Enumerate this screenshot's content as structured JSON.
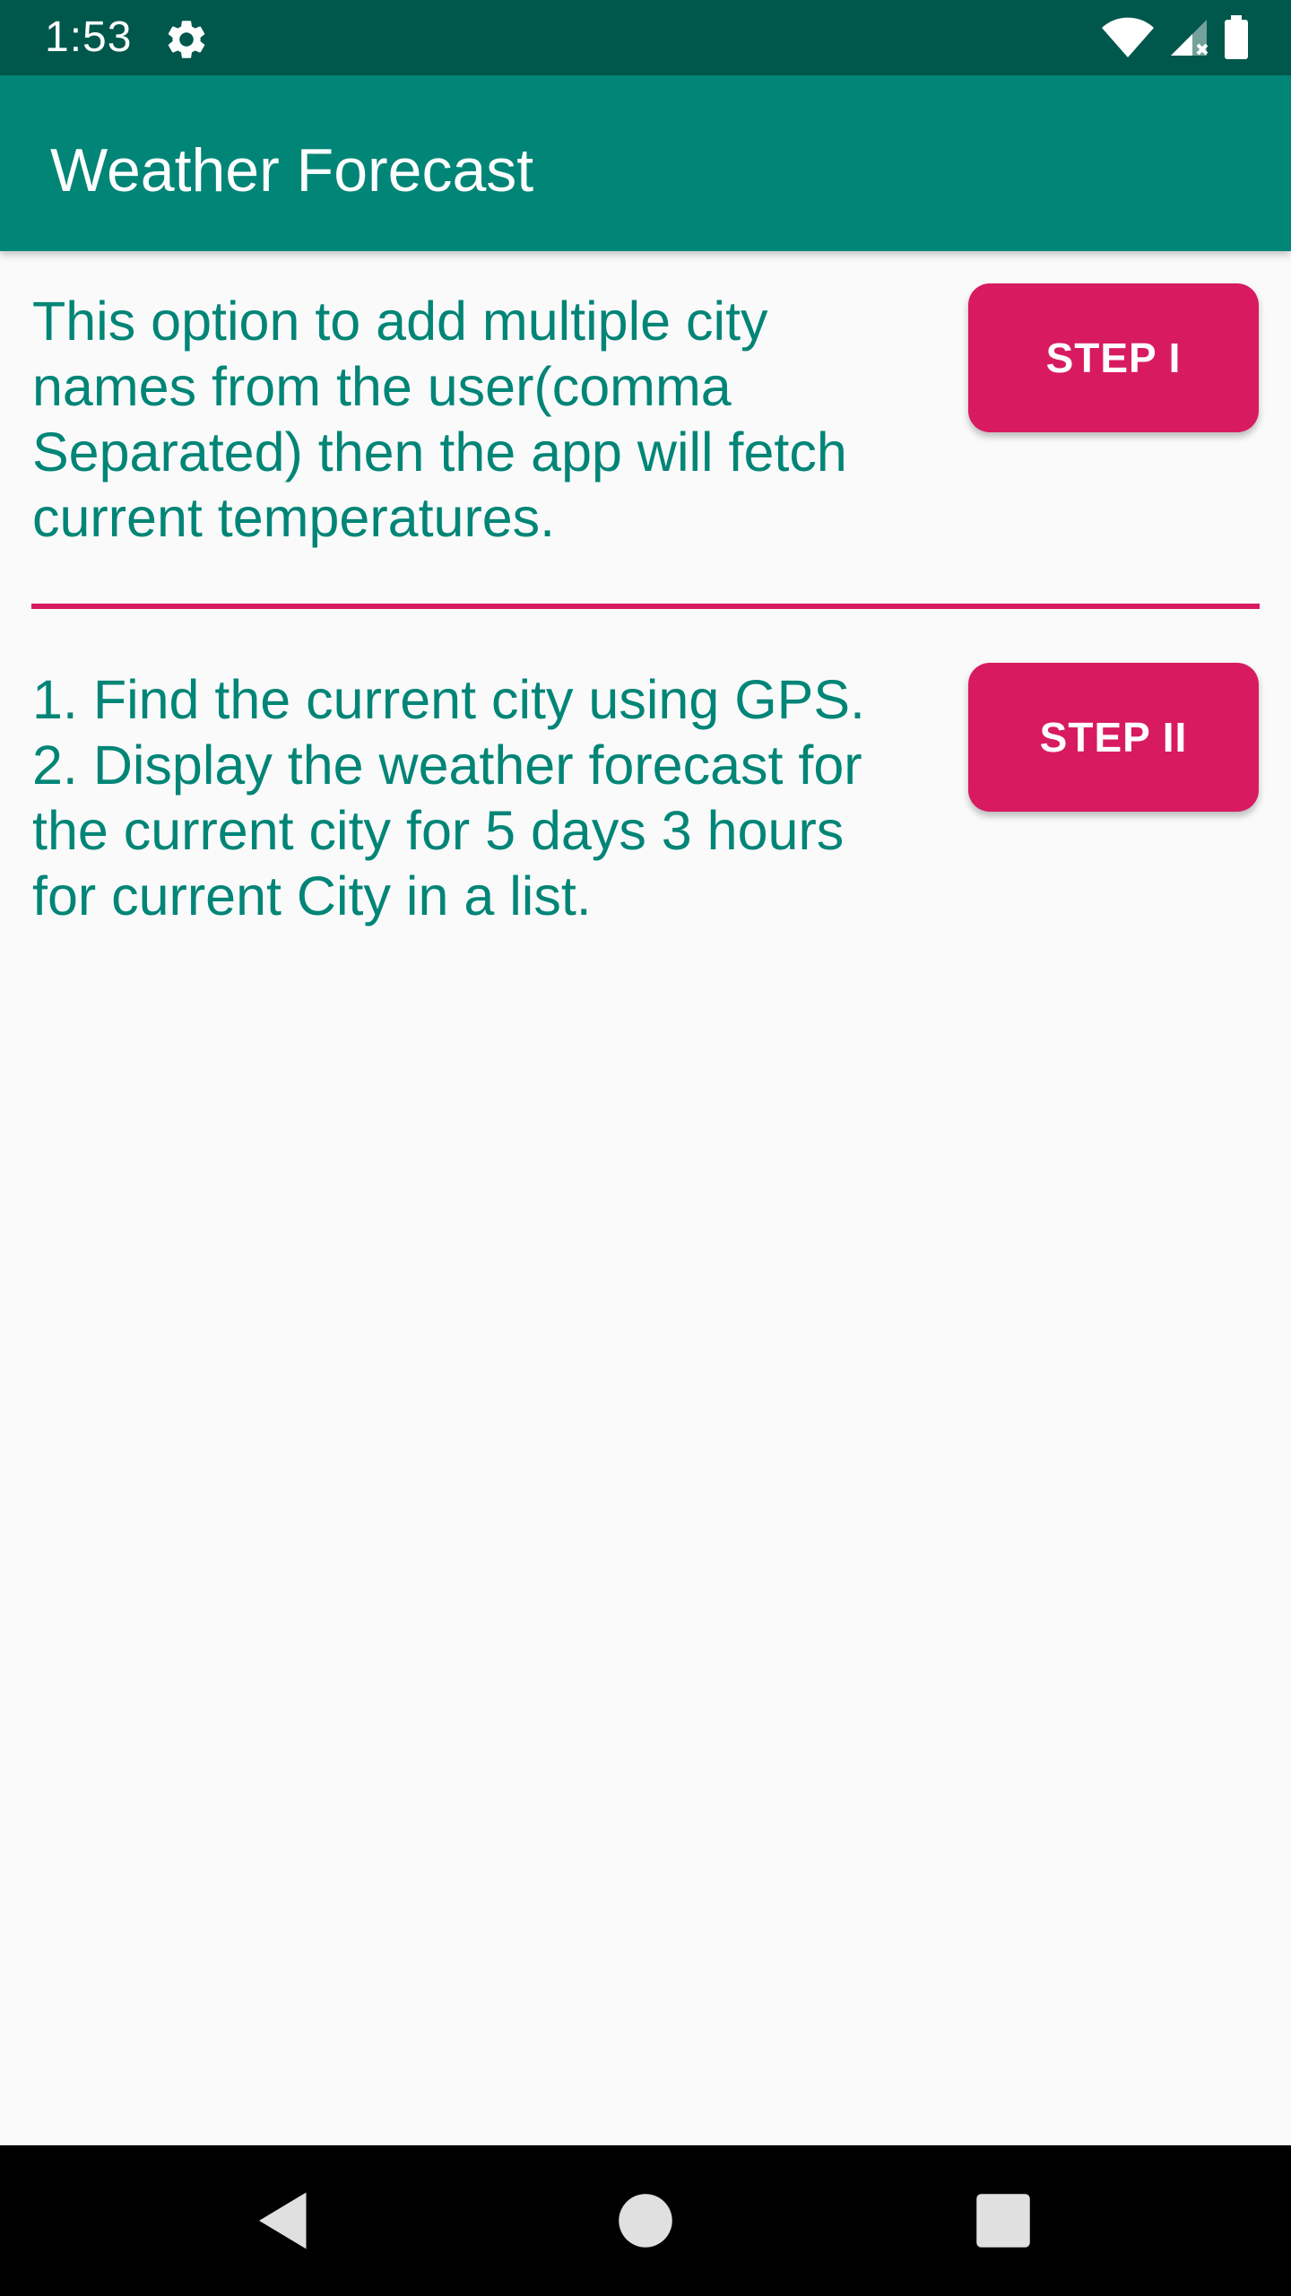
{
  "status_bar": {
    "time": "1:53",
    "icons": [
      "settings-gear-icon",
      "wifi-icon",
      "cellular-signal-icon",
      "battery-icon"
    ]
  },
  "app_bar": {
    "title": "Weather Forecast"
  },
  "section_1": {
    "description_lines": [
      "This option to add multiple city",
      "names from the user(comma",
      "Separated) then the app will fetch",
      "current temperatures."
    ],
    "button_label": "STEP I"
  },
  "section_2": {
    "description_lines": [
      "1. Find the current city using GPS.",
      "2. Display the weather forecast for",
      "the current city for 5 days 3 hours",
      "for current City in a list."
    ],
    "button_label": "STEP II"
  },
  "nav_bar": {
    "buttons": [
      "back-icon",
      "home-icon",
      "recents-icon"
    ]
  },
  "colors": {
    "status_bar": "#00574b",
    "app_bar": "#008577",
    "accent": "#d81b60",
    "text": "#008577",
    "background": "#fafafa"
  }
}
